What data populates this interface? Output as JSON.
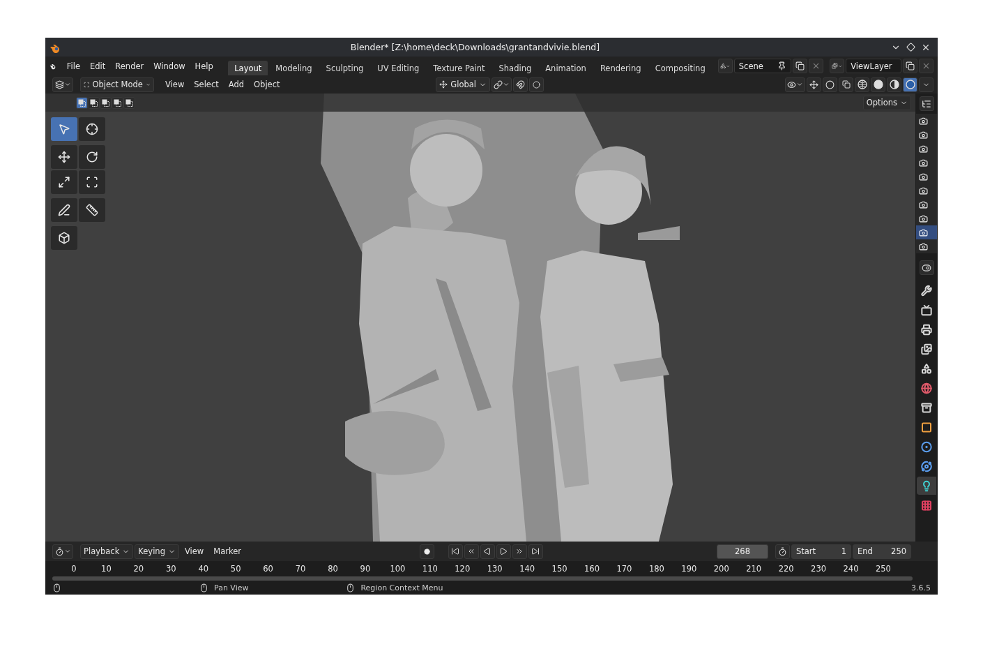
{
  "window": {
    "title": "Blender* [Z:\\home\\deck\\Downloads\\grantandvivie.blend]"
  },
  "menu": [
    "File",
    "Edit",
    "Render",
    "Window",
    "Help"
  ],
  "workspaces": [
    {
      "label": "Layout",
      "selected": true
    },
    {
      "label": "Modeling",
      "selected": false
    },
    {
      "label": "Sculpting",
      "selected": false
    },
    {
      "label": "UV Editing",
      "selected": false
    },
    {
      "label": "Texture Paint",
      "selected": false
    },
    {
      "label": "Shading",
      "selected": false
    },
    {
      "label": "Animation",
      "selected": false
    },
    {
      "label": "Rendering",
      "selected": false
    },
    {
      "label": "Compositing",
      "selected": false
    }
  ],
  "scene": {
    "value": "Scene"
  },
  "view_layer": {
    "value": "ViewLayer"
  },
  "header": {
    "mode": "Object Mode",
    "menus": [
      "View",
      "Select",
      "Add",
      "Object"
    ],
    "orientation": "Global"
  },
  "shading_modes": [
    {
      "kind": "wireframe",
      "selected": false
    },
    {
      "kind": "solid",
      "selected": false
    },
    {
      "kind": "material",
      "selected": false
    },
    {
      "kind": "rendered",
      "selected": true
    }
  ],
  "select_modes": [
    {
      "selected": true
    },
    {
      "selected": false
    },
    {
      "selected": false
    },
    {
      "selected": false
    },
    {
      "selected": false
    }
  ],
  "options": {
    "label": "Options"
  },
  "tools": [
    {
      "kind": "select",
      "selected": true
    },
    {
      "kind": "cursor",
      "selected": false
    },
    {
      "kind": "move",
      "selected": false
    },
    {
      "kind": "rotate",
      "selected": false
    },
    {
      "kind": "scale",
      "selected": false
    },
    {
      "kind": "transform",
      "selected": false
    },
    {
      "kind": "annotate",
      "selected": false
    },
    {
      "kind": "measure",
      "selected": false
    },
    {
      "kind": "add-cube",
      "selected": false
    }
  ],
  "outliner_rows": [
    {
      "selected": false
    },
    {
      "selected": false
    },
    {
      "selected": false
    },
    {
      "selected": false
    },
    {
      "selected": false
    },
    {
      "selected": false
    },
    {
      "selected": false
    },
    {
      "selected": false
    },
    {
      "selected": true
    },
    {
      "selected": false
    }
  ],
  "property_tabs": [
    {
      "kind": "tool",
      "color": "#d8d8d8",
      "selected": false
    },
    {
      "kind": "render",
      "color": "#d8d8d8",
      "selected": false
    },
    {
      "kind": "output",
      "color": "#d8d8d8",
      "selected": false
    },
    {
      "kind": "view-layer",
      "color": "#d8d8d8",
      "selected": false
    },
    {
      "kind": "scene",
      "color": "#d8d8d8",
      "selected": false
    },
    {
      "kind": "world",
      "color": "#e05a6a",
      "selected": false
    },
    {
      "kind": "collection",
      "color": "#d8d8d8",
      "selected": false
    },
    {
      "kind": "object",
      "color": "#f0a040",
      "selected": false
    },
    {
      "kind": "physics",
      "color": "#5b9ef0",
      "selected": false
    },
    {
      "kind": "constraint",
      "color": "#5b9ef0",
      "selected": false
    },
    {
      "kind": "light",
      "color": "#3fd0d0",
      "selected": true
    },
    {
      "kind": "texture",
      "color": "#e04060",
      "selected": false
    }
  ],
  "timeline": {
    "menus": [
      {
        "label": "Playback",
        "dropdown": true
      },
      {
        "label": "Keying",
        "dropdown": true
      },
      {
        "label": "View",
        "dropdown": false
      },
      {
        "label": "Marker",
        "dropdown": false
      }
    ],
    "current_frame": "268",
    "start": {
      "label": "Start",
      "value": "1"
    },
    "end": {
      "label": "End",
      "value": "250"
    },
    "ticks": [
      "0",
      "10",
      "20",
      "30",
      "40",
      "50",
      "60",
      "70",
      "80",
      "90",
      "100",
      "110",
      "120",
      "130",
      "140",
      "150",
      "160",
      "170",
      "180",
      "190",
      "200",
      "210",
      "220",
      "230",
      "240",
      "250"
    ]
  },
  "status_bar": {
    "items": [
      "Pan View",
      "Region Context Menu"
    ],
    "version": "3.6.5"
  }
}
